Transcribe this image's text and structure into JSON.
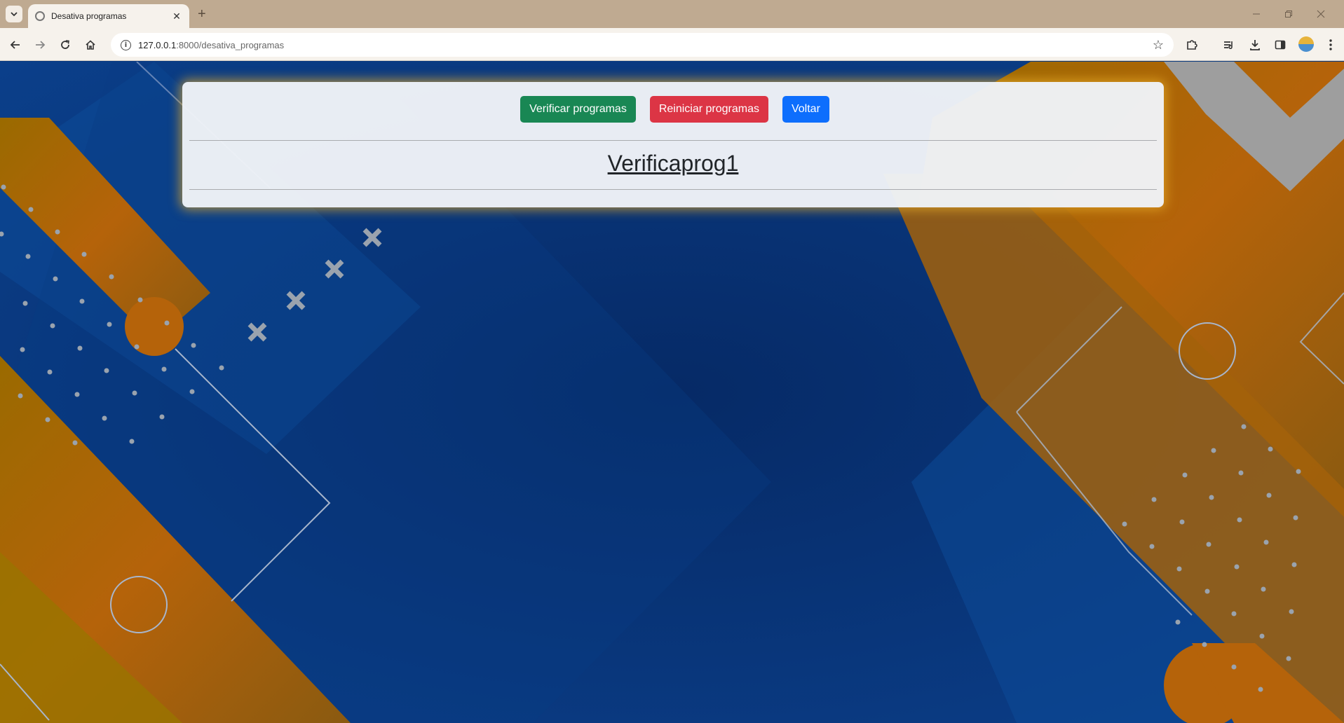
{
  "browser": {
    "tab_title": "Desativa programas",
    "url_host": "127.0.0.1",
    "url_path": ":8000/desativa_programas",
    "new_tab": "+",
    "tab_close": "✕"
  },
  "page": {
    "buttons": {
      "verificar": "Verificar programas",
      "reiniciar": "Reiniciar programas",
      "voltar": "Voltar"
    },
    "programs": [
      "Verificaprog1"
    ]
  },
  "colors": {
    "green": "#198754",
    "red": "#dc3545",
    "blue": "#0d6efd"
  }
}
